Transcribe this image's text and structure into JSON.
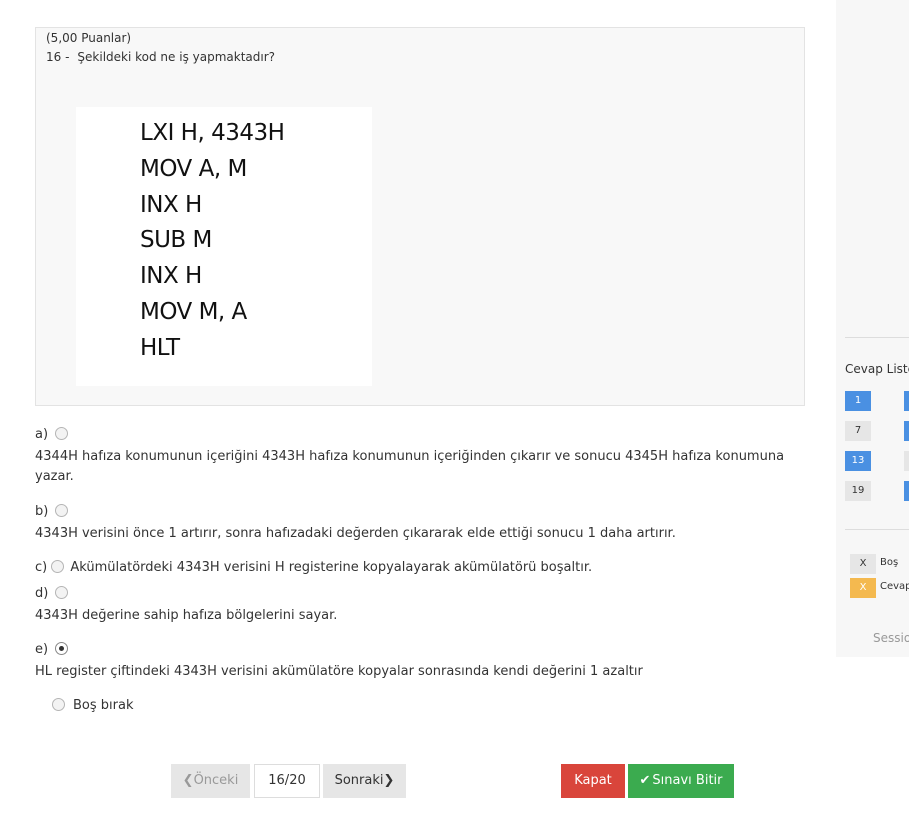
{
  "question": {
    "points": "(5,00 Puanlar)",
    "number": "16 -",
    "text": "Şekildeki kod ne iş yapmaktadır?",
    "code_lines": [
      "LXI H, 4343H",
      "MOV A, M",
      "INX H",
      "SUB M",
      "INX H",
      "MOV M, A",
      "HLT"
    ]
  },
  "options": [
    {
      "letter": "a)",
      "text": "4344H hafıza konumunun içeriğini 4343H hafıza konumunun içeriğinden çıkarır ve sonucu 4345H hafıza konumuna yazar.",
      "selected": false
    },
    {
      "letter": "b)",
      "text": "4343H verisini önce 1 artırır, sonra hafızadaki değerden çıkararak elde ettiği sonucu 1 daha artırır.",
      "selected": false
    },
    {
      "letter": "c)",
      "text": "Akümülatördeki 4343H verisini H registerine kopyalayarak akümülatörü boşaltır.",
      "selected": false
    },
    {
      "letter": "d)",
      "text": "4343H değerine sahip hafıza bölgelerini sayar.",
      "selected": false
    },
    {
      "letter": "e)",
      "text": "HL register çiftindeki 4343H verisini akümülatöre kopyalar sonrasında kendi değerini 1 azaltır",
      "selected": true
    }
  ],
  "skip_label": "Boş bırak",
  "nav": {
    "prev_label": "Önceki",
    "page": "16/20",
    "next_label": "Sonraki",
    "close_label": "Kapat",
    "finish_label": "Sınavı Bitir"
  },
  "sidebar": {
    "title": "Cevap Liste",
    "answer_numbers": [
      {
        "num": "1",
        "status": "answered"
      },
      {
        "num": "7",
        "status": "empty"
      },
      {
        "num": "13",
        "status": "answered"
      },
      {
        "num": "19",
        "status": "empty"
      }
    ],
    "legend": [
      {
        "mark": "X",
        "label": "Boş"
      },
      {
        "mark": "X",
        "label": "Cevap"
      }
    ],
    "session_text": "Sessio"
  },
  "colors": {
    "answered": "#4a90e2",
    "empty": "#e6e6e6",
    "close_button": "#d9453b",
    "finish_button": "#3bab4f",
    "legend_answered": "#f4b94f"
  }
}
